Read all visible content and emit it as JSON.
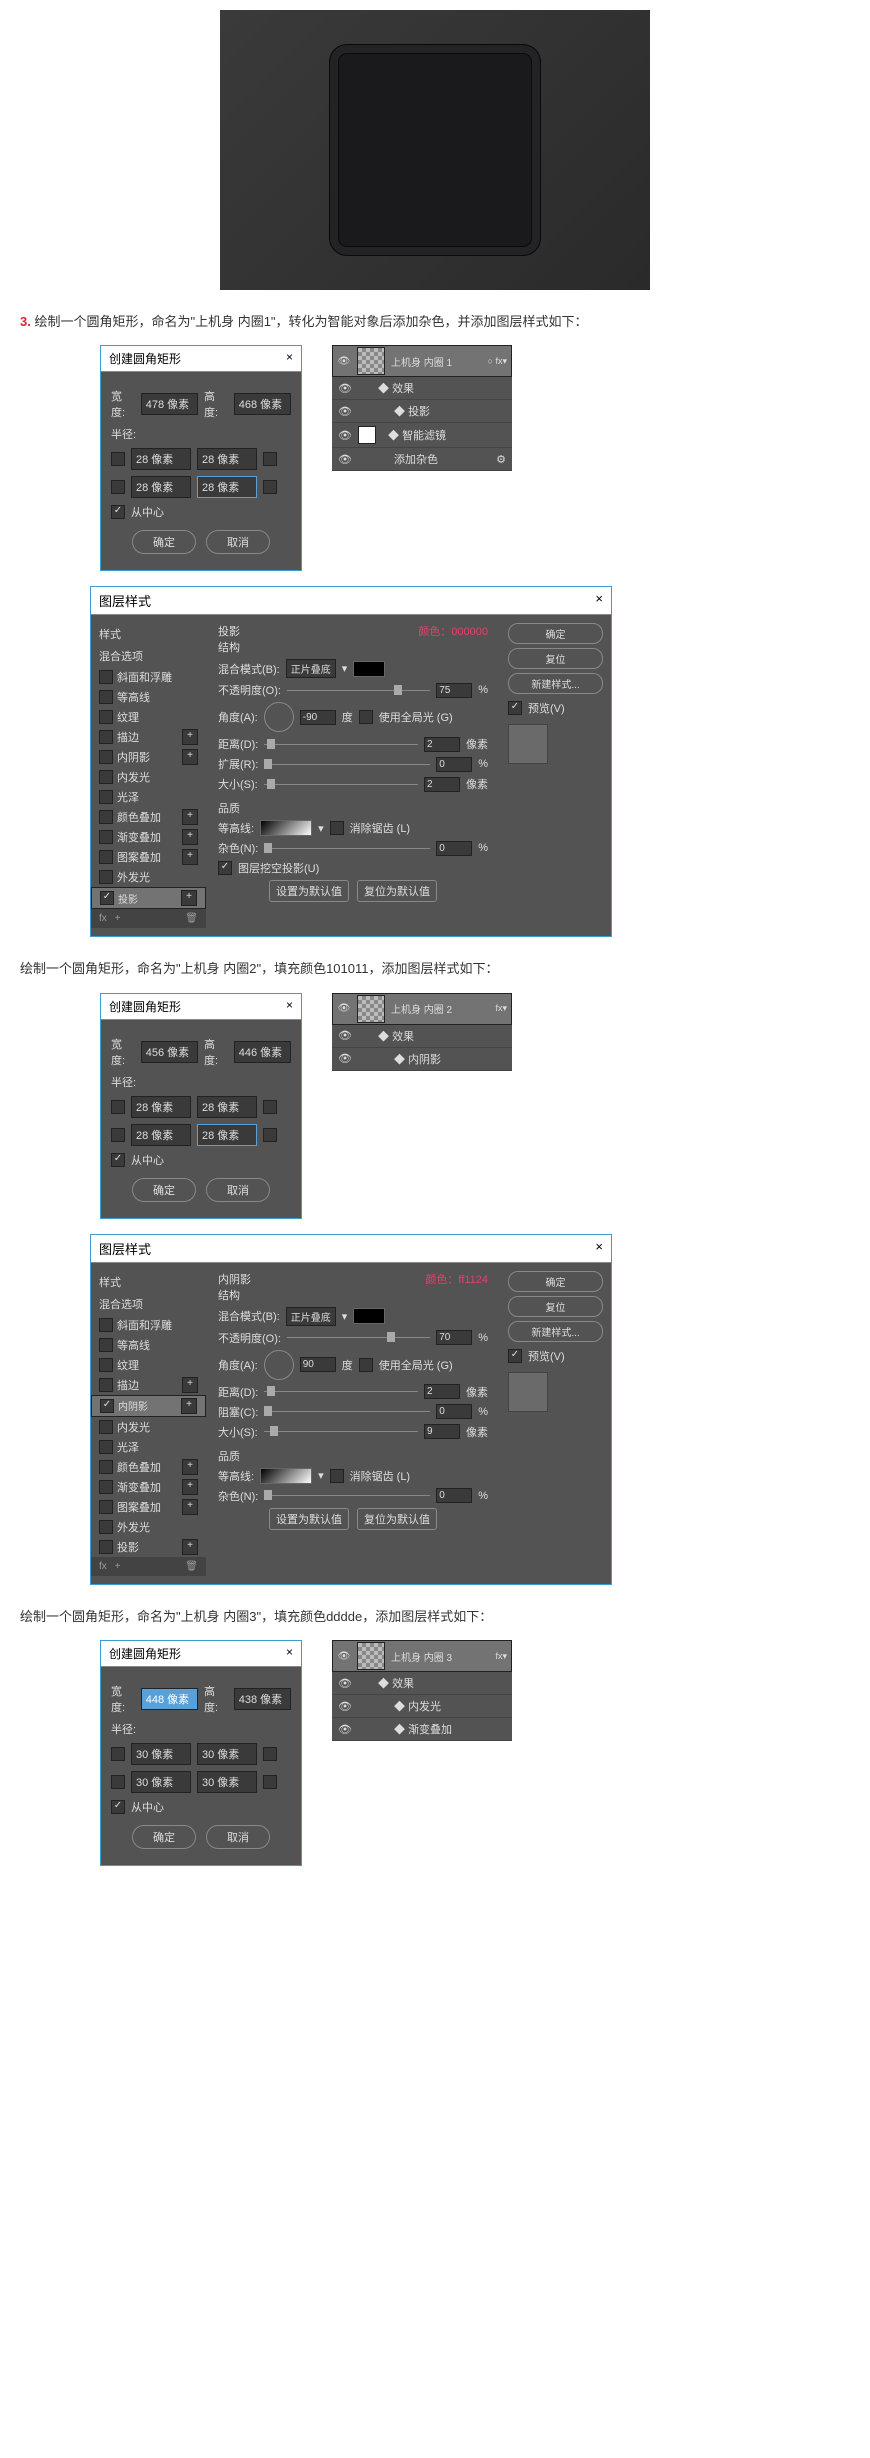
{
  "step3": {
    "num": "3.",
    "text": "绘制一个圆角矩形，命名为\"上机身 内圈1\"，转化为智能对象后添加杂色，并添加图层样式如下："
  },
  "dlg1": {
    "title": "创建圆角矩形",
    "close": "×",
    "w_lbl": "宽度:",
    "w": "478 像素",
    "h_lbl": "高度:",
    "h": "468 像素",
    "radius": "半径:",
    "r1": "28 像素",
    "r2": "28 像素",
    "r3": "28 像素",
    "r4": "28 像素",
    "center": "从中心",
    "ok": "确定",
    "cancel": "取消"
  },
  "layers1": {
    "name": "上机身  内圈 1",
    "fx": "fx",
    "effects": "效果",
    "drop": "投影",
    "smart": "智能滤镜",
    "noise": "添加杂色"
  },
  "blend1": {
    "title": "图层样式",
    "close": "×",
    "left_hdr": "样式",
    "opts_hdr": "混合选项",
    "items": [
      "斜面和浮雕",
      "等高线",
      "纹理",
      "描边",
      "内阴影",
      "内发光",
      "光泽",
      "颜色叠加",
      "渐变叠加",
      "图案叠加",
      "外发光",
      "投影"
    ],
    "sel_idx": 11,
    "mid_hdr": "投影",
    "pink": "颜色：000000",
    "struct": "结构",
    "blend_mode_lbl": "混合模式(B):",
    "blend_mode": "正片叠底",
    "opacity_lbl": "不透明度(O):",
    "opacity": "75",
    "pct": "%",
    "angle_lbl": "角度(A):",
    "angle": "-90",
    "deg": "度",
    "global": "使用全局光 (G)",
    "dist_lbl": "距离(D):",
    "dist": "2",
    "px": "像素",
    "spread_lbl": "扩展(R):",
    "spread": "0",
    "size_lbl": "大小(S):",
    "size": "2",
    "quality": "品质",
    "contour_lbl": "等高线:",
    "anti": "消除锯齿 (L)",
    "noise_lbl": "杂色(N):",
    "noise": "0",
    "knock": "图层挖空投影(U)",
    "default_btn": "设置为默认值",
    "reset_btn": "复位为默认值",
    "r_ok": "确定",
    "r_cancel": "复位",
    "r_new": "新建样式...",
    "r_preview": "预览(V)",
    "fx": "fx",
    "plus": "+",
    "trash": "🗑"
  },
  "step4": {
    "text": "绘制一个圆角矩形，命名为\"上机身 内圈2\"，填充颜色101011，添加图层样式如下："
  },
  "dlg2": {
    "title": "创建圆角矩形",
    "w": "456 像素",
    "h": "446 像素",
    "r1": "28 像素",
    "r2": "28 像素",
    "r3": "28 像素",
    "r4": "28 像素"
  },
  "layers2": {
    "name": "上机身  内圈 2",
    "fx": "fx",
    "effects": "效果",
    "inner": "内阴影"
  },
  "blend2": {
    "title": "图层样式",
    "mid_hdr": "内阴影",
    "pink": "颜色：ff1124",
    "sel_idx": 4,
    "blend_mode": "正片叠底",
    "opacity": "70",
    "angle": "90",
    "dist": "2",
    "choke_lbl": "阻塞(C):",
    "choke": "0",
    "size": "9",
    "noise": "0"
  },
  "step5": {
    "text": "绘制一个圆角矩形，命名为\"上机身 内圈3\"，填充颜色dddde，添加图层样式如下："
  },
  "dlg3": {
    "title": "创建圆角矩形",
    "w": "448 像素",
    "h": "438 像素",
    "r1": "30 像素",
    "r2": "30 像素",
    "r3": "30 像素",
    "r4": "30 像素"
  },
  "layers3": {
    "name": "上机身  内圈 3",
    "fx": "fx",
    "effects": "效果",
    "glow": "内发光",
    "grad": "渐变叠加"
  }
}
